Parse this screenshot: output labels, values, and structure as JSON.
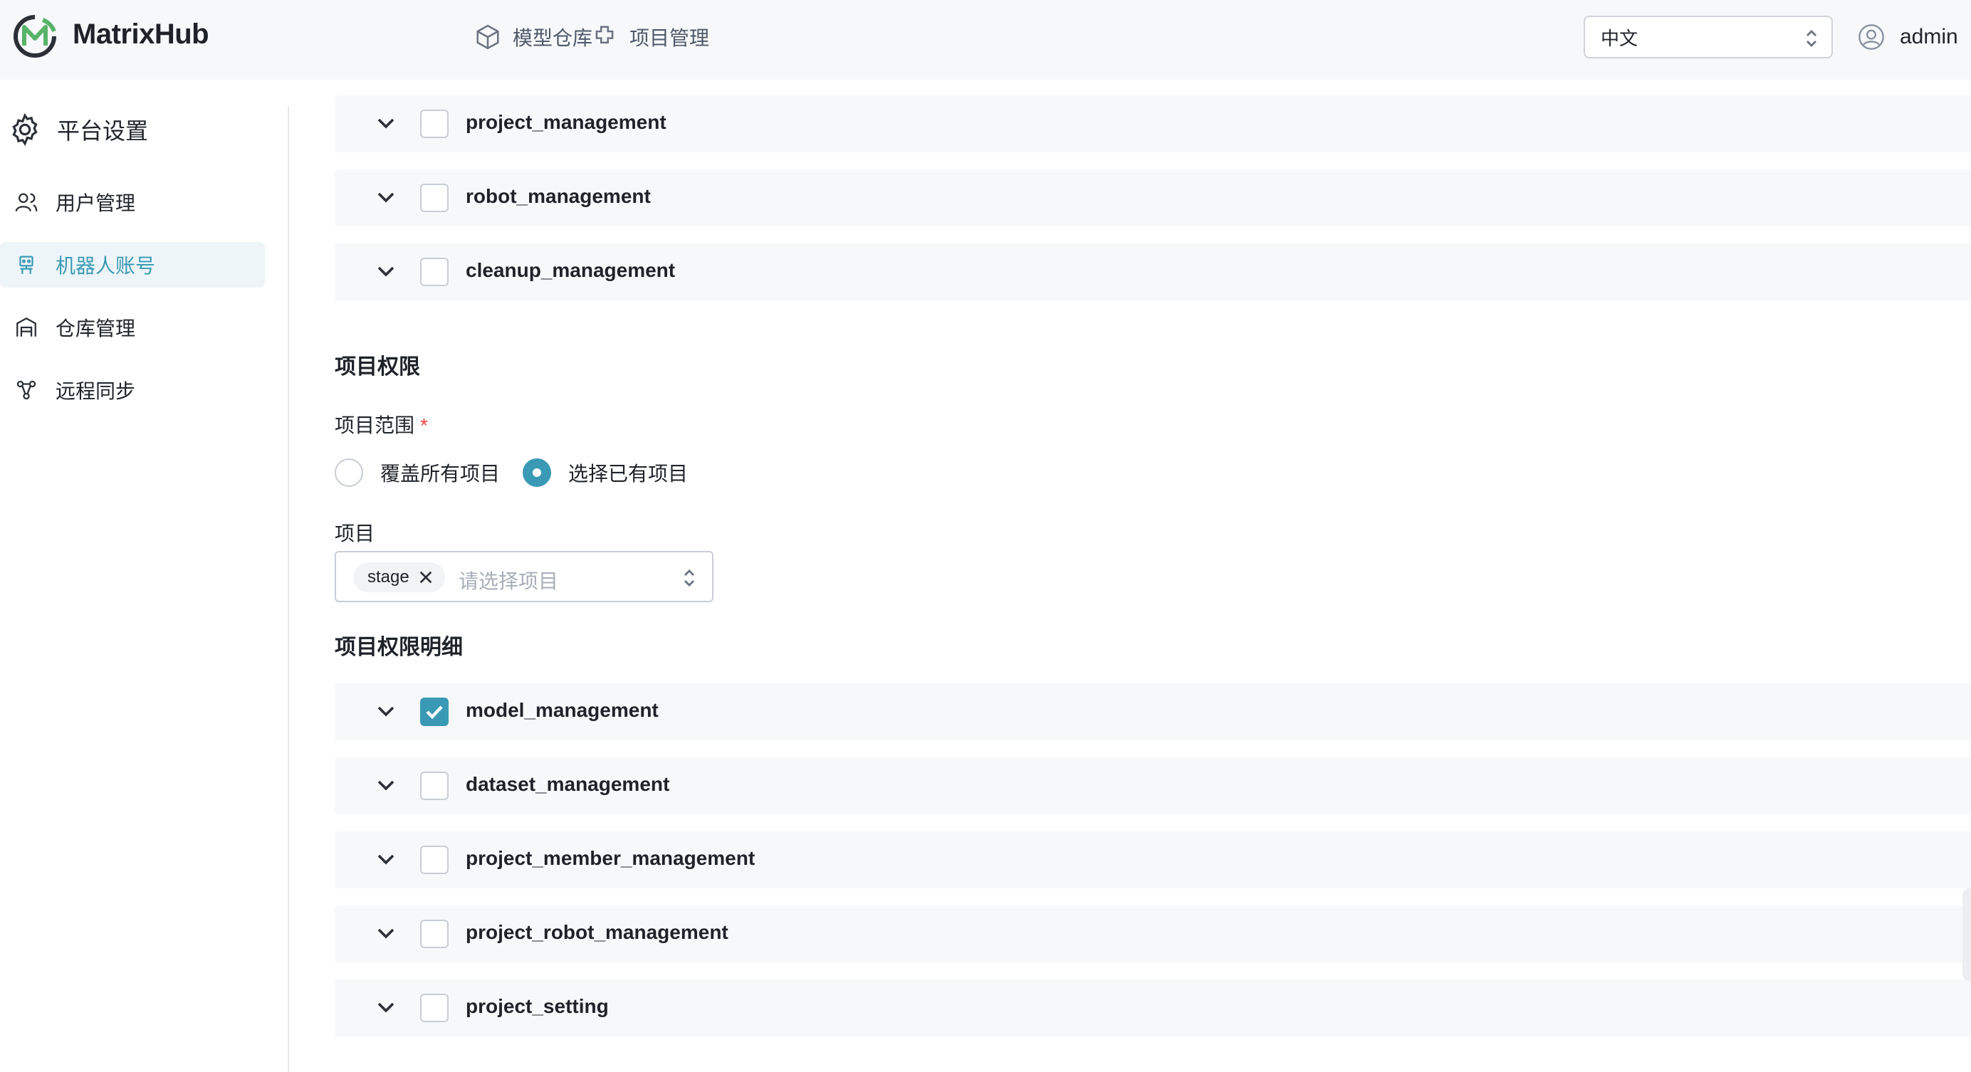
{
  "app": {
    "brand": "MatrixHub"
  },
  "topnav": [
    {
      "label": "模型仓库",
      "icon": "cube-icon"
    },
    {
      "label": "项目管理",
      "icon": "puzzle-icon"
    }
  ],
  "language": {
    "value": "中文"
  },
  "user": {
    "name": "admin"
  },
  "sidebar": {
    "title": "平台设置",
    "items": [
      {
        "label": "用户管理",
        "icon": "users-icon",
        "active": false
      },
      {
        "label": "机器人账号",
        "icon": "robot-icon",
        "active": true
      },
      {
        "label": "仓库管理",
        "icon": "warehouse-icon",
        "active": false
      },
      {
        "label": "远程同步",
        "icon": "sync-icon",
        "active": false
      }
    ]
  },
  "system_permissions": [
    {
      "label": "project_management",
      "checked": false
    },
    {
      "label": "robot_management",
      "checked": false
    },
    {
      "label": "cleanup_management",
      "checked": false
    }
  ],
  "project_permissions": {
    "title": "项目权限",
    "scope_label": "项目范围",
    "scope_required": "*",
    "scope_options": [
      {
        "label": "覆盖所有项目",
        "selected": false
      },
      {
        "label": "选择已有项目",
        "selected": true
      }
    ],
    "project_label": "项目",
    "selected_tags": [
      "stage"
    ],
    "project_placeholder": "请选择项目",
    "details_title": "项目权限明细",
    "details": [
      {
        "label": "model_management",
        "checked": true
      },
      {
        "label": "dataset_management",
        "checked": false
      },
      {
        "label": "project_member_management",
        "checked": false
      },
      {
        "label": "project_robot_management",
        "checked": false
      },
      {
        "label": "project_setting",
        "checked": false
      }
    ]
  },
  "colors": {
    "accent": "#3a9ab5",
    "required": "#f53f3f",
    "row_bg": "#f7f8fa"
  }
}
